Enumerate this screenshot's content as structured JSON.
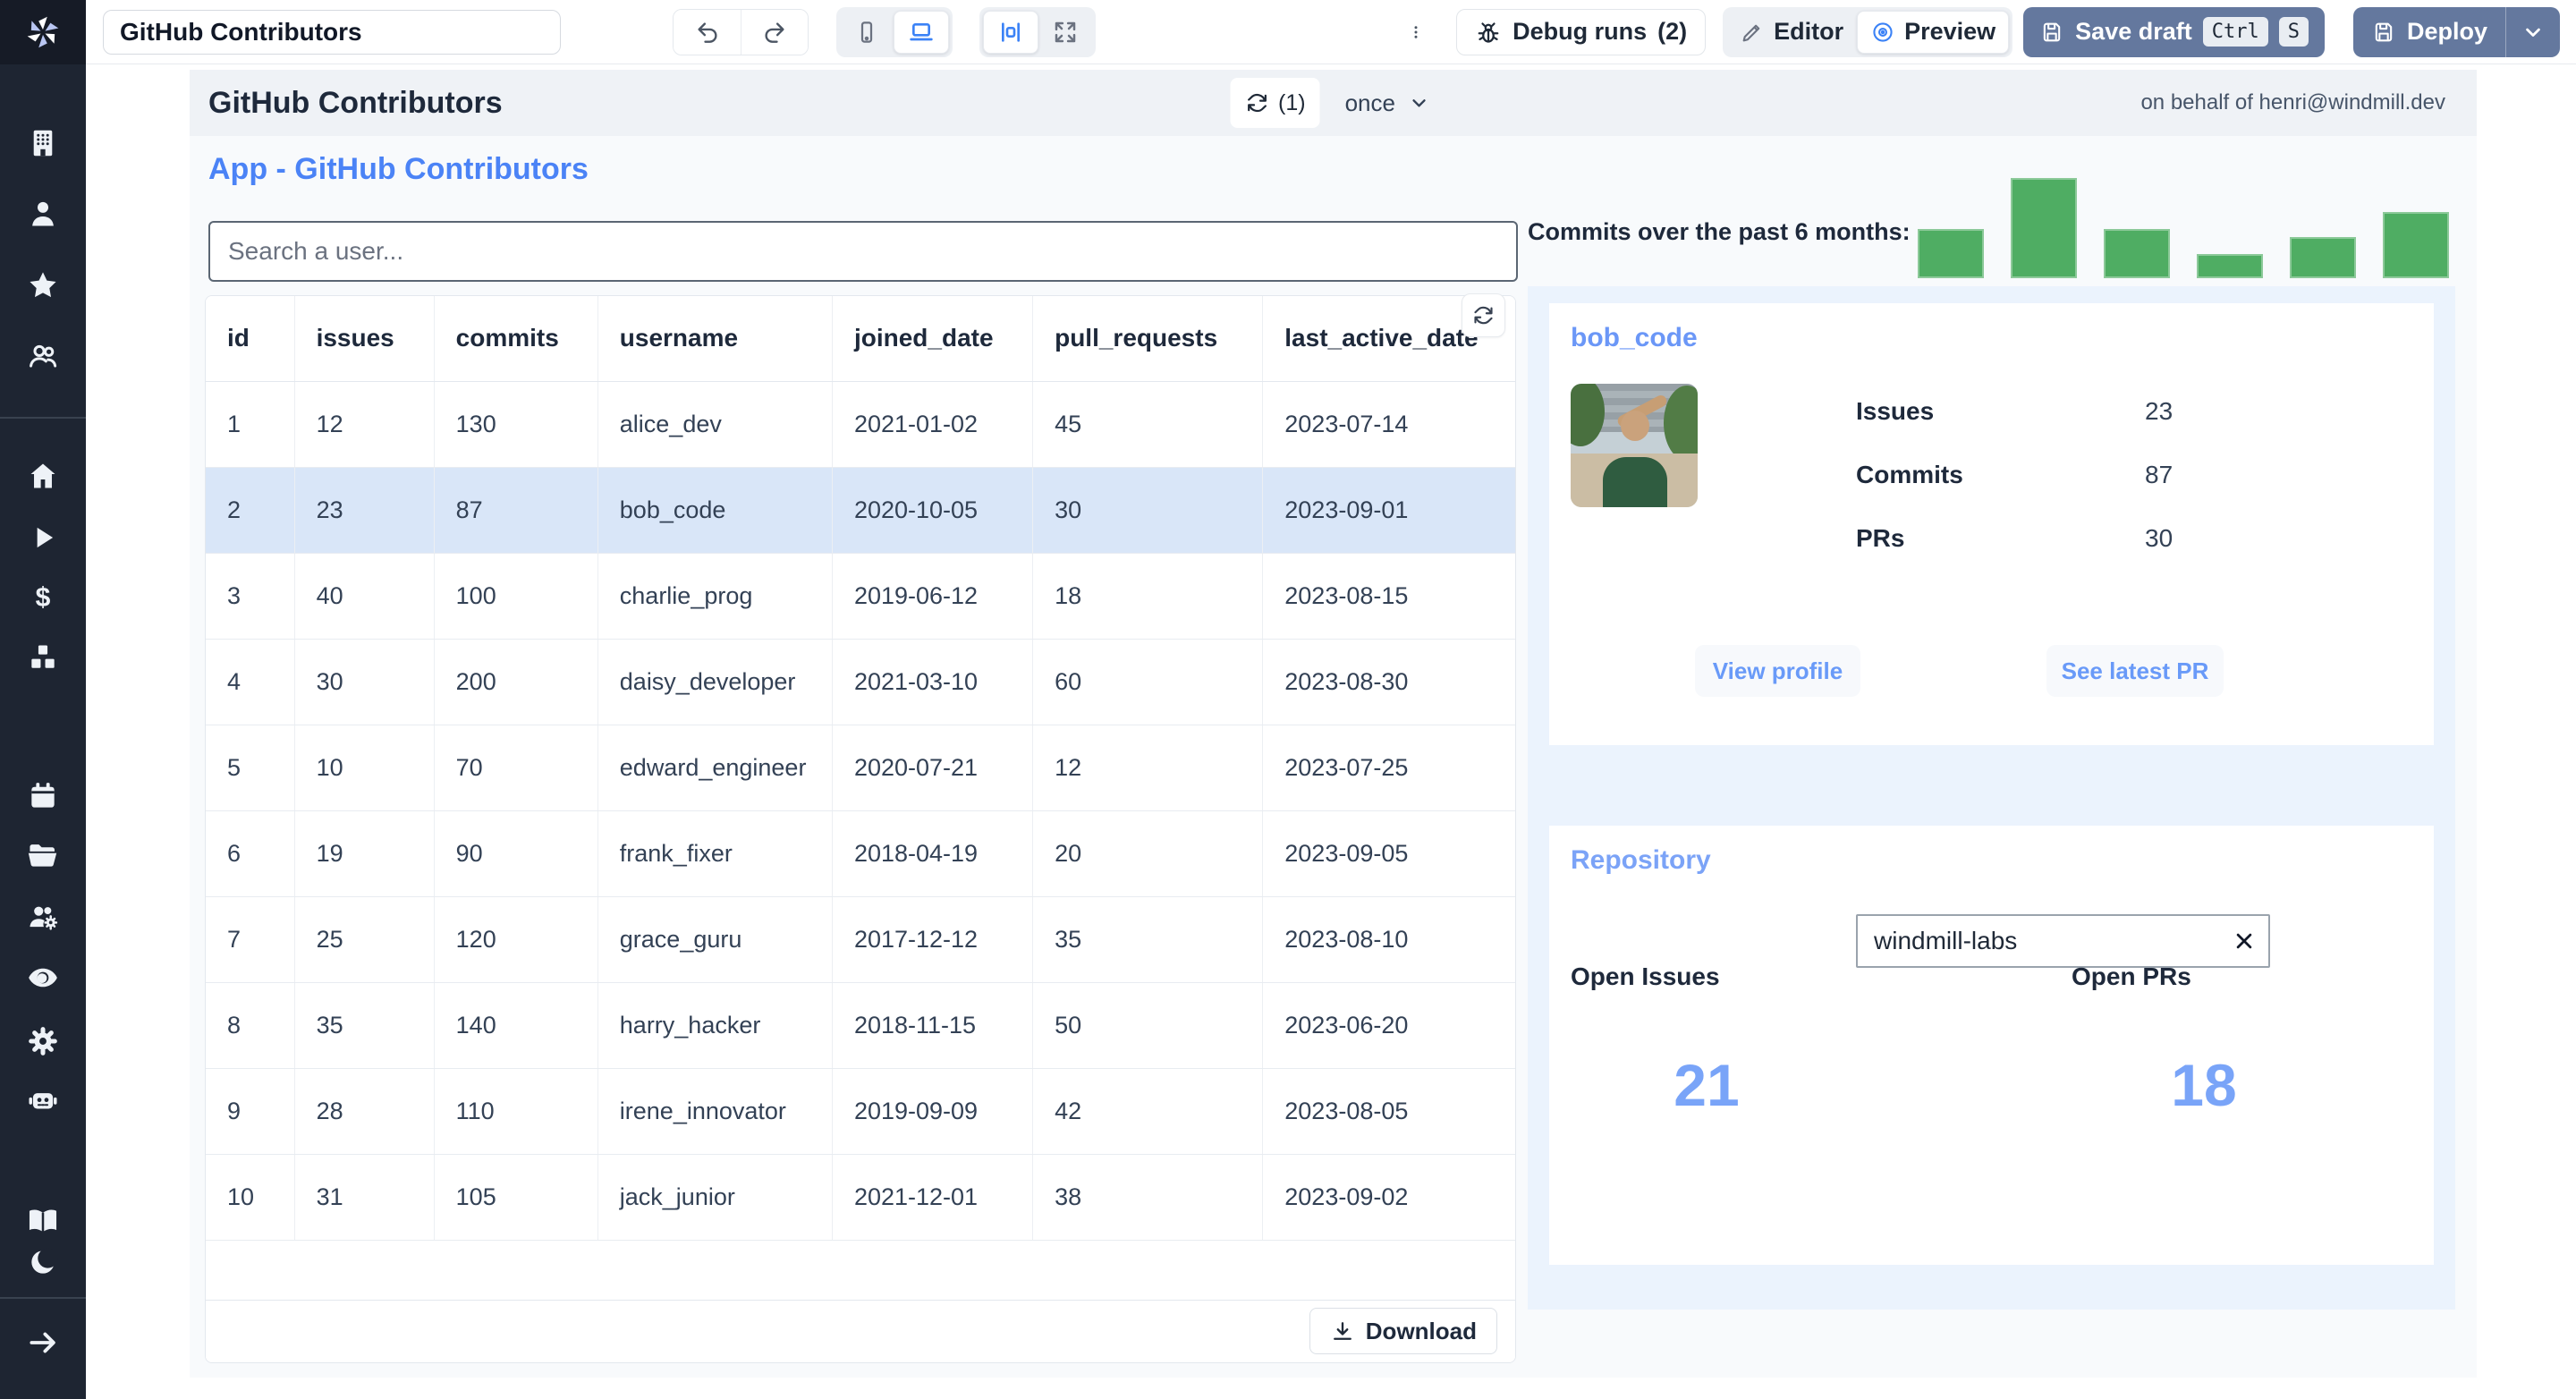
{
  "toolbar": {
    "app_title_value": "GitHub Contributors",
    "debug_runs_label": "Debug runs",
    "debug_runs_count": "(2)",
    "editor_label": "Editor",
    "preview_label": "Preview",
    "save_draft_label": "Save draft",
    "kbd_ctrl": "Ctrl",
    "kbd_s": "S",
    "deploy_label": "Deploy",
    "icons": [
      "undo-icon",
      "redo-icon",
      "mobile-icon",
      "laptop-icon",
      "center-align-icon",
      "fullscreen-icon",
      "kebab-menu-icon",
      "bug-icon",
      "pencil-icon",
      "eye-icon",
      "save-icon",
      "chevron-down-icon"
    ]
  },
  "sidebar": {
    "icons": [
      "windmill-logo",
      "building-icon",
      "person-icon",
      "star-icon",
      "group-icon",
      "home-icon",
      "play-icon",
      "dollar-icon",
      "cubes-icon",
      "calendar-icon",
      "folder-icon",
      "users-gear-icon",
      "eye-icon",
      "gear-icon",
      "robot-icon",
      "book-icon",
      "moon-icon",
      "arrow-right-icon"
    ]
  },
  "header": {
    "title": "GitHub Contributors",
    "refresh_count": "(1)",
    "schedule_label": "once",
    "on_behalf": "on behalf of henri@windmill.dev"
  },
  "app": {
    "heading": "App - GitHub Contributors",
    "search_placeholder": "Search a user...",
    "table": {
      "columns": [
        "id",
        "issues",
        "commits",
        "username",
        "joined_date",
        "pull_requests",
        "last_active_date"
      ],
      "rows": [
        [
          "1",
          "12",
          "130",
          "alice_dev",
          "2021-01-02",
          "45",
          "2023-07-14"
        ],
        [
          "2",
          "23",
          "87",
          "bob_code",
          "2020-10-05",
          "30",
          "2023-09-01"
        ],
        [
          "3",
          "40",
          "100",
          "charlie_prog",
          "2019-06-12",
          "18",
          "2023-08-15"
        ],
        [
          "4",
          "30",
          "200",
          "daisy_developer",
          "2021-03-10",
          "60",
          "2023-08-30"
        ],
        [
          "5",
          "10",
          "70",
          "edward_engineer",
          "2020-07-21",
          "12",
          "2023-07-25"
        ],
        [
          "6",
          "19",
          "90",
          "frank_fixer",
          "2018-04-19",
          "20",
          "2023-09-05"
        ],
        [
          "7",
          "25",
          "120",
          "grace_guru",
          "2017-12-12",
          "35",
          "2023-08-10"
        ],
        [
          "8",
          "35",
          "140",
          "harry_hacker",
          "2018-11-15",
          "50",
          "2023-06-20"
        ],
        [
          "9",
          "28",
          "110",
          "irene_innovator",
          "2019-09-09",
          "42",
          "2023-08-05"
        ],
        [
          "10",
          "31",
          "105",
          "jack_junior",
          "2021-12-01",
          "38",
          "2023-09-02"
        ]
      ],
      "selected_row_index": 1,
      "download_label": "Download"
    },
    "chart": {
      "type": "bar",
      "label": "Commits over the past 6 months:",
      "values": [
        49,
        100,
        49,
        24,
        41,
        66
      ],
      "color": "#4fad63"
    },
    "user_card": {
      "title": "bob_code",
      "stats": [
        {
          "label": "Issues",
          "value": "23"
        },
        {
          "label": "Commits",
          "value": "87"
        },
        {
          "label": "PRs",
          "value": "30"
        }
      ],
      "buttons": [
        "View profile",
        "See latest PR"
      ]
    },
    "repo_card": {
      "title": "Repository",
      "input_value": "windmill-labs",
      "metrics": [
        {
          "label": "Open Issues",
          "value": "21"
        },
        {
          "label": "Open PRs",
          "value": "18"
        }
      ]
    }
  }
}
